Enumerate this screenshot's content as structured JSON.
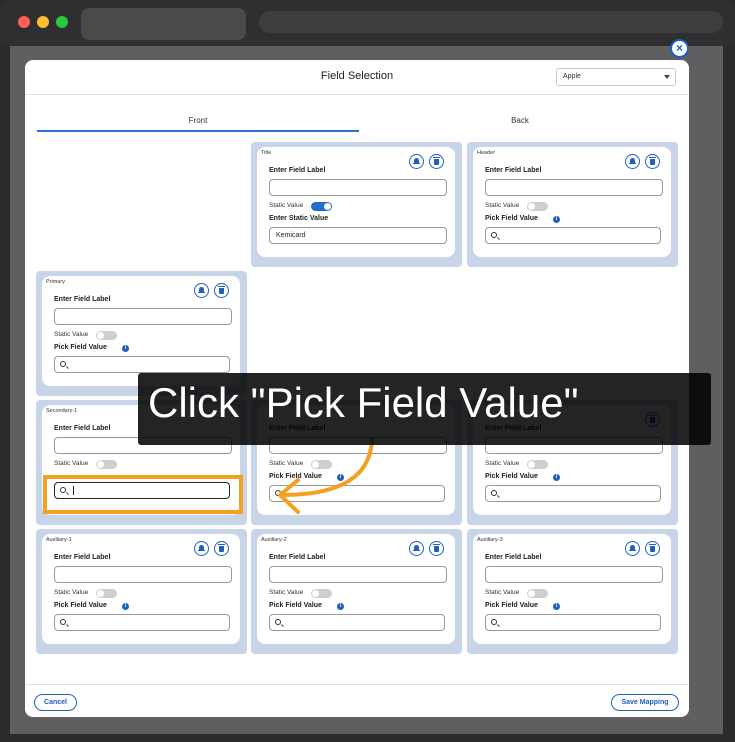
{
  "dialog": {
    "title": "Field Selection",
    "category_select": "Apple",
    "tabs": {
      "front": "Front",
      "back": "Back"
    },
    "cancel": "Cancel",
    "save": "Save Mapping"
  },
  "common": {
    "enter_field_label": "Enter Field Label",
    "static_value": "Static Value",
    "enter_static_value": "Enter Static Value",
    "pick_field_value": "Pick Field Value"
  },
  "cards": {
    "title": {
      "name": "Title",
      "static_value_input": "Kemicard"
    },
    "header": {
      "name": "Header"
    },
    "primary": {
      "name": "Primary"
    },
    "secondary1": {
      "name": "Secondary-1"
    },
    "auxiliary1": {
      "name": "Auxiliary-1"
    },
    "auxiliary2": {
      "name": "Auxiliary-2"
    },
    "auxiliary3": {
      "name": "Auxiliary-3"
    }
  },
  "overlay": {
    "instruction": "Click \"Pick Field Value\""
  },
  "colors": {
    "accent": "#1f5fbf",
    "card_bg": "#c8d5e8",
    "highlight": "#f4a020"
  }
}
